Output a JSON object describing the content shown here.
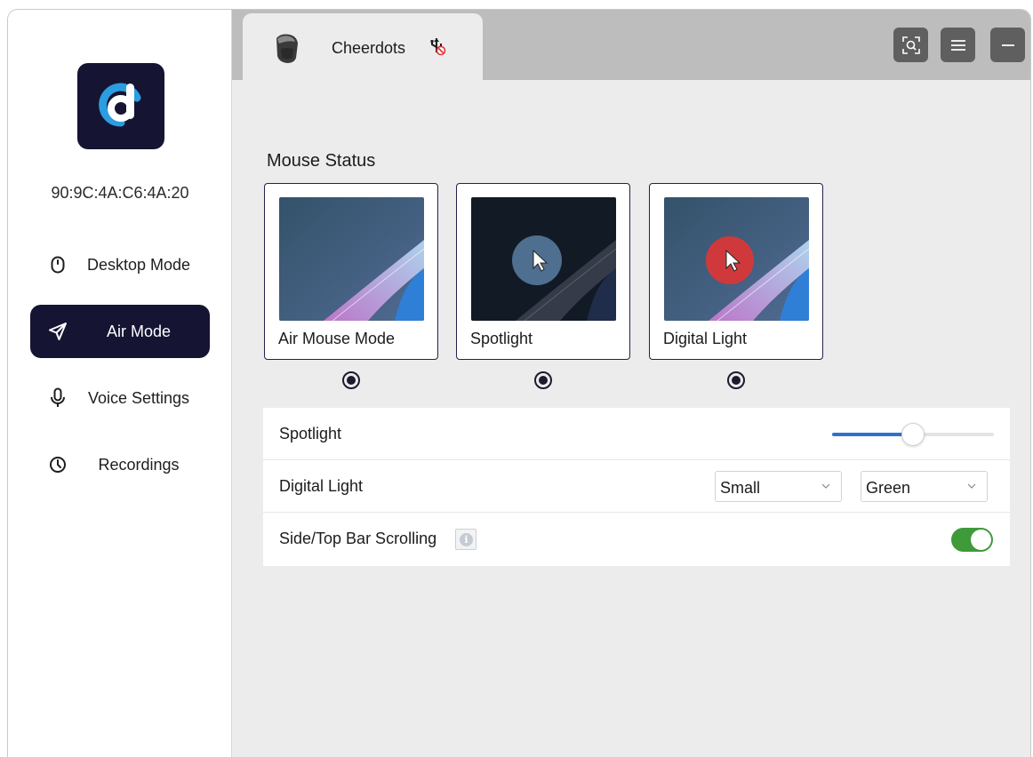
{
  "app": {
    "device_id": "90:9C:4A:C6:4A:20",
    "tab_title": "Cheerdots"
  },
  "sidebar": {
    "items": [
      {
        "label": "Desktop Mode",
        "icon": "mouse-icon",
        "active": false
      },
      {
        "label": "Air Mode",
        "icon": "send-icon",
        "active": true
      },
      {
        "label": "Voice Settings",
        "icon": "microphone-icon",
        "active": false
      },
      {
        "label": "Recordings",
        "icon": "clock-icon",
        "active": false
      }
    ]
  },
  "toolbar": {
    "buttons": [
      "screen-search-icon",
      "menu-icon",
      "minimize-icon"
    ]
  },
  "main": {
    "section_title": "Mouse Status",
    "modes": [
      {
        "label": "Air Mouse Mode",
        "selected": true
      },
      {
        "label": "Spotlight",
        "selected": true
      },
      {
        "label": "Digital Light",
        "selected": true
      }
    ],
    "settings": {
      "spotlight_label": "Spotlight",
      "spotlight_level": 0.5,
      "digital_light_label": "Digital Light",
      "digital_light_size": "Small",
      "digital_light_color": "Green",
      "scrolling_label": "Side/Top Bar Scrolling",
      "scrolling_enabled": true
    }
  },
  "colors": {
    "sidebar_active": "#161433",
    "accent_blue": "#2f72cc",
    "toggle_on": "#3f9a3a",
    "spotlight_circle": "#4e6f90",
    "digital_light_circle": "#d0393b"
  }
}
